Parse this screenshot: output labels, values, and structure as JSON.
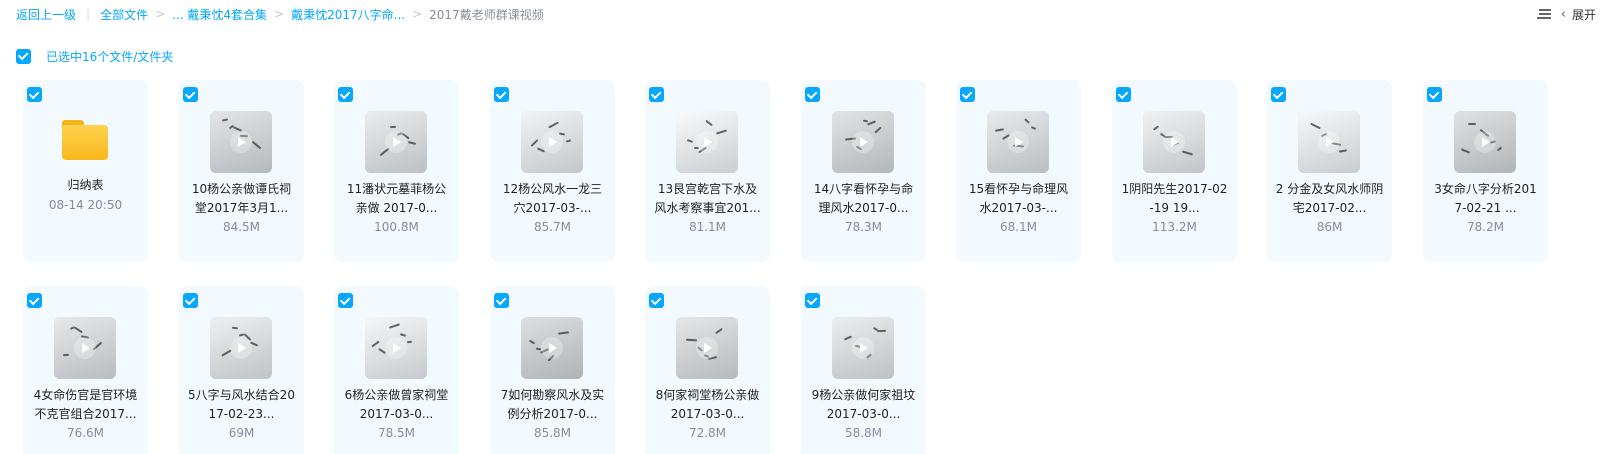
{
  "breadcrumb": {
    "back": "返回上一级",
    "root": "全部文件",
    "level1": "... 戴秉忱4套合集",
    "level2": "戴秉忱2017八字命...",
    "current": "2017戴老师群课视频"
  },
  "top_right": {
    "list_view_icon": "list-view-icon",
    "collapse_label": "展开"
  },
  "selection": {
    "summary": "已选中16个文件/文件夹"
  },
  "colors": {
    "accent": "#06a7ff",
    "card_bg": "#f2f9ff",
    "meta_text": "#878c9c"
  },
  "files": [
    {
      "type": "folder",
      "name": "归纳表",
      "meta": "08-14 20:50",
      "checked": true
    },
    {
      "type": "video",
      "name": "10杨公亲做谭氏祠堂2017年3月1...",
      "meta": "84.5M",
      "checked": true
    },
    {
      "type": "video",
      "name": "11潘状元墓菲杨公亲做 2017-0...",
      "meta": "100.8M",
      "checked": true
    },
    {
      "type": "video",
      "name": "12杨公风水一龙三穴2017-03-...",
      "meta": "85.7M",
      "checked": true
    },
    {
      "type": "video",
      "name": "13艮宫乾宫下水及风水考察事宜201...",
      "meta": "81.1M",
      "checked": true
    },
    {
      "type": "video",
      "name": "14八字看怀孕与命理风水2017-0...",
      "meta": "78.3M",
      "checked": true
    },
    {
      "type": "video",
      "name": "15看怀孕与命理风水2017-03-...",
      "meta": "68.1M",
      "checked": true
    },
    {
      "type": "video",
      "name": "1阴阳先生2017-02-19 19...",
      "meta": "113.2M",
      "checked": true
    },
    {
      "type": "video",
      "name": "2 分金及女风水师阴宅2017-02...",
      "meta": "86M",
      "checked": true
    },
    {
      "type": "video",
      "name": "3女命八字分析2017-02-21 ...",
      "meta": "78.2M",
      "checked": true
    },
    {
      "type": "video",
      "name": "4女命伤官是官环境不克官组合2017...",
      "meta": "76.6M",
      "checked": true
    },
    {
      "type": "video",
      "name": "5八字与风水结合2017-02-23...",
      "meta": "69M",
      "checked": true
    },
    {
      "type": "video",
      "name": "6杨公亲做曾家祠堂2017-03-0...",
      "meta": "78.5M",
      "checked": true
    },
    {
      "type": "video",
      "name": "7如何勘察风水及实例分析2017-0...",
      "meta": "85.8M",
      "checked": true
    },
    {
      "type": "video",
      "name": "8何家祠堂杨公亲做2017-03-0...",
      "meta": "72.8M",
      "checked": true
    },
    {
      "type": "video",
      "name": "9杨公亲做何家祖坟2017-03-0...",
      "meta": "58.8M",
      "checked": true
    }
  ]
}
